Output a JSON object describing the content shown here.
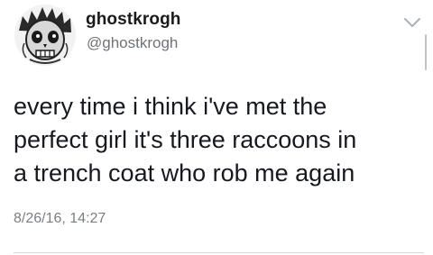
{
  "tweet": {
    "author": {
      "display_name": "ghostkrogh",
      "handle": "@ghostkrogh",
      "avatar_icon": "skull-avatar-icon"
    },
    "text_lines": [
      "every time i think i've met the",
      "perfect girl it's three raccoons in",
      "a trench coat who rob me again"
    ],
    "timestamp": "8/26/16, 14:27",
    "menu_icon": "chevron-down-icon"
  },
  "colors": {
    "name": "#1b1b1b",
    "handle": "#6e7378",
    "body_text": "#161a20",
    "timestamp": "#7a7f84",
    "divider": "#d6d9dc"
  }
}
